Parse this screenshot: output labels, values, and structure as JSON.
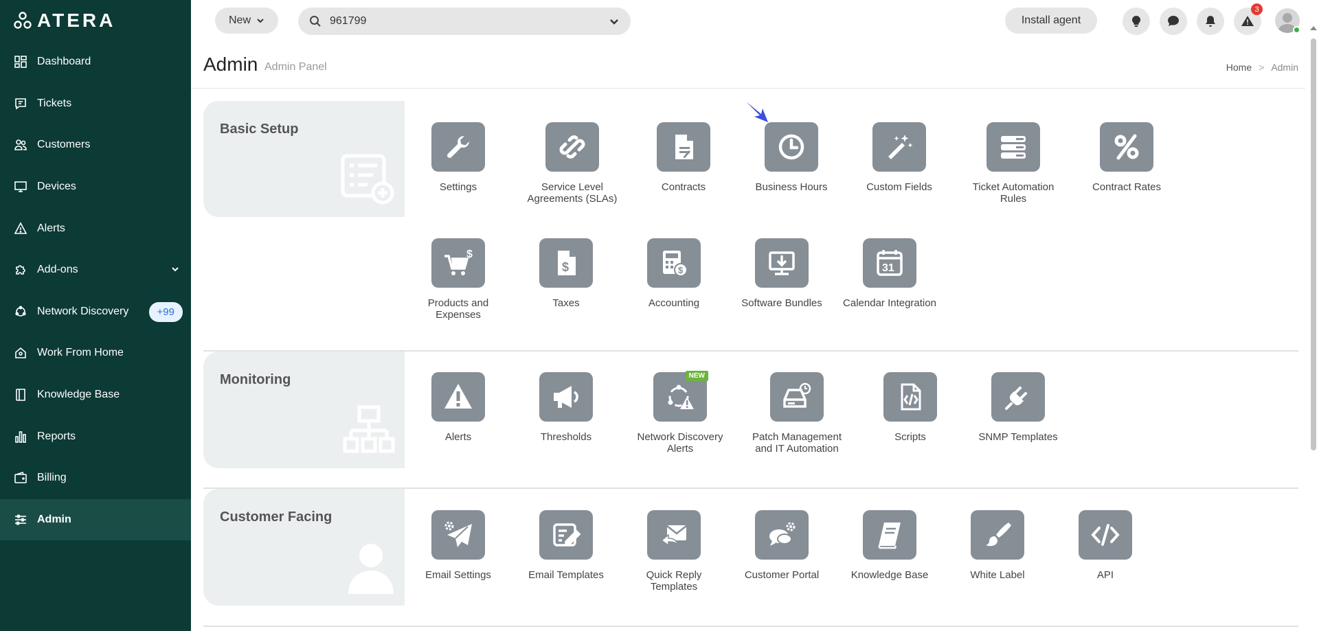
{
  "brand": {
    "name": "ATERA"
  },
  "sidebar": {
    "items": [
      {
        "label": "Dashboard",
        "icon": "dashboard-icon"
      },
      {
        "label": "Tickets",
        "icon": "ticket-icon"
      },
      {
        "label": "Customers",
        "icon": "customers-icon"
      },
      {
        "label": "Devices",
        "icon": "monitor-icon"
      },
      {
        "label": "Alerts",
        "icon": "alert-triangle-icon"
      },
      {
        "label": "Add-ons",
        "icon": "puzzle-icon"
      },
      {
        "label": "Network Discovery",
        "icon": "network-icon",
        "badge": "+99"
      },
      {
        "label": "Work From Home",
        "icon": "home-icon"
      },
      {
        "label": "Knowledge Base",
        "icon": "book-icon"
      },
      {
        "label": "Reports",
        "icon": "bar-chart-icon"
      },
      {
        "label": "Billing",
        "icon": "wallet-icon"
      },
      {
        "label": "Admin",
        "icon": "sliders-icon",
        "active": true
      }
    ]
  },
  "topbar": {
    "new_label": "New",
    "search_value": "961799",
    "install_label": "Install agent",
    "alerts_badge": "3"
  },
  "header": {
    "title": "Admin",
    "subtitle": "Admin Panel",
    "breadcrumb_home": "Home",
    "breadcrumb_sep": ">",
    "breadcrumb_current": "Admin"
  },
  "sections": {
    "basic": {
      "title": "Basic Setup",
      "tiles": [
        {
          "label": "Settings",
          "icon": "wrench-icon"
        },
        {
          "label": "Service Level Agreements (SLAs)",
          "icon": "link-icon"
        },
        {
          "label": "Contracts",
          "icon": "contract-document-icon"
        },
        {
          "label": "Business Hours",
          "icon": "clock-icon"
        },
        {
          "label": "Custom Fields",
          "icon": "magic-wand-icon"
        },
        {
          "label": "Ticket Automation Rules",
          "icon": "server-stack-icon"
        },
        {
          "label": "Contract Rates",
          "icon": "percent-icon"
        },
        {
          "label": "Products and Expenses",
          "icon": "shopping-cart-icon"
        },
        {
          "label": "Taxes",
          "icon": "dollar-document-icon"
        },
        {
          "label": "Accounting",
          "icon": "calculator-icon"
        },
        {
          "label": "Software Bundles",
          "icon": "download-monitor-icon"
        },
        {
          "label": "Calendar Integration",
          "icon": "calendar-icon",
          "day": "31"
        }
      ]
    },
    "monitoring": {
      "title": "Monitoring",
      "tiles": [
        {
          "label": "Alerts",
          "icon": "alert-triangle-icon"
        },
        {
          "label": "Thresholds",
          "icon": "megaphone-icon"
        },
        {
          "label": "Network Discovery Alerts",
          "icon": "network-alert-icon",
          "tag": "NEW"
        },
        {
          "label": "Patch Management and IT Automation",
          "icon": "drive-clock-icon"
        },
        {
          "label": "Scripts",
          "icon": "code-file-icon"
        },
        {
          "label": "SNMP Templates",
          "icon": "plug-icon"
        }
      ]
    },
    "customer": {
      "title": "Customer Facing",
      "tiles": [
        {
          "label": "Email Settings",
          "icon": "paper-plane-gear-icon"
        },
        {
          "label": "Email Templates",
          "icon": "form-edit-icon"
        },
        {
          "label": "Quick Reply Templates",
          "icon": "envelope-reply-icon"
        },
        {
          "label": "Customer Portal",
          "icon": "chat-gear-icon"
        },
        {
          "label": "Knowledge Base",
          "icon": "book-icon"
        },
        {
          "label": "White Label",
          "icon": "brush-icon"
        },
        {
          "label": "API",
          "icon": "code-brackets-icon"
        }
      ]
    }
  },
  "colors": {
    "sidebar_bg": "#0c3a35",
    "tile_bg": "#868e96",
    "panel_bg": "#eceff0",
    "pointer": "#3b4fe0"
  }
}
